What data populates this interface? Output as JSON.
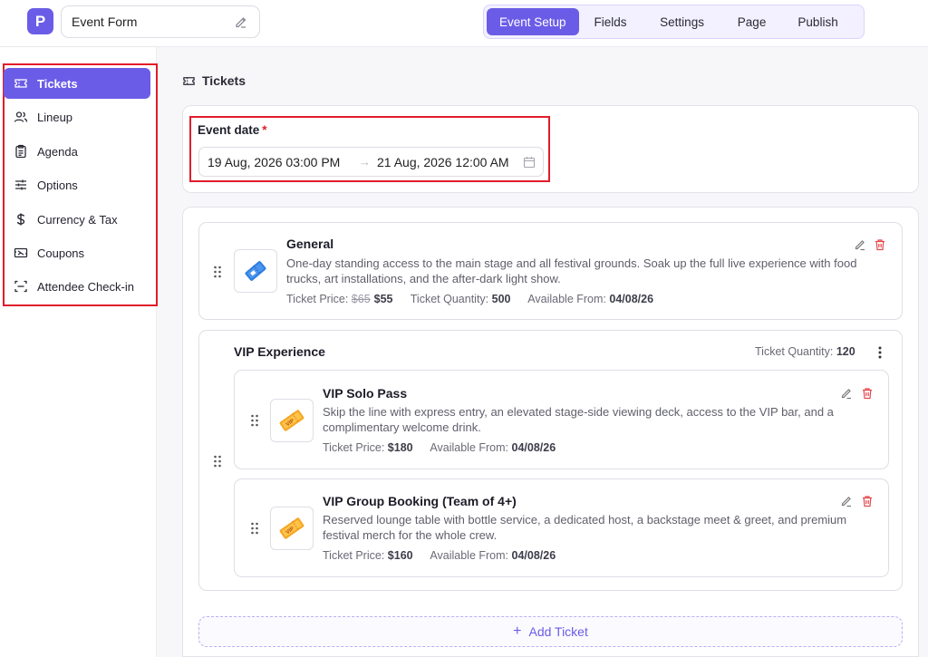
{
  "app": {
    "logo_letter": "P",
    "form_name": "Event Form"
  },
  "tabs": [
    {
      "label": "Event Setup",
      "active": true
    },
    {
      "label": "Fields",
      "active": false
    },
    {
      "label": "Settings",
      "active": false
    },
    {
      "label": "Page",
      "active": false
    },
    {
      "label": "Publish",
      "active": false
    }
  ],
  "sidebar": {
    "items": [
      {
        "label": "Tickets",
        "icon": "ticket-icon",
        "active": true
      },
      {
        "label": "Lineup",
        "icon": "users-icon",
        "active": false
      },
      {
        "label": "Agenda",
        "icon": "clipboard-icon",
        "active": false
      },
      {
        "label": "Options",
        "icon": "sliders-icon",
        "active": false
      },
      {
        "label": "Currency & Tax",
        "icon": "dollar-icon",
        "active": false
      },
      {
        "label": "Coupons",
        "icon": "coupon-icon",
        "active": false
      },
      {
        "label": "Attendee Check-in",
        "icon": "scan-icon",
        "active": false
      }
    ]
  },
  "main": {
    "section_title": "Tickets",
    "event_date": {
      "label": "Event date",
      "required_mark": "*",
      "start": "19 Aug, 2026 03:00 PM",
      "arrow": "→",
      "end": "21 Aug, 2026 12:00 AM"
    },
    "general": {
      "name": "General",
      "description": "One-day standing access to the main stage and all festival grounds. Soak up the full live experience with food trucks, art installations, and the after-dark light show.",
      "price_label": "Ticket Price:",
      "old_price": "$65",
      "price": "$55",
      "quantity_label": "Ticket Quantity:",
      "quantity": "500",
      "available_label": "Available From:",
      "available": "04/08/26"
    },
    "vip_group": {
      "name": "VIP Experience",
      "quantity_label": "Ticket Quantity:",
      "quantity": "120",
      "tickets": [
        {
          "name": "VIP Solo Pass",
          "description": "Skip the line with express entry, an elevated stage-side viewing deck, access to the VIP bar, and a complimentary welcome drink.",
          "price_label": "Ticket Price:",
          "price": "$180",
          "available_label": "Available From:",
          "available": "04/08/26"
        },
        {
          "name": "VIP Group Booking (Team of 4+)",
          "description": "Reserved lounge table with bottle service, a dedicated host, a backstage meet & greet, and premium festival merch for the whole crew.",
          "price_label": "Ticket Price:",
          "price": "$160",
          "available_label": "Available From:",
          "available": "04/08/26"
        }
      ]
    },
    "add_ticket_label": "Add Ticket",
    "add_ticket_plus": "+"
  },
  "colors": {
    "accent": "#6b5ce7",
    "highlight_border": "#e11d2b",
    "delete": "#e5484d"
  }
}
